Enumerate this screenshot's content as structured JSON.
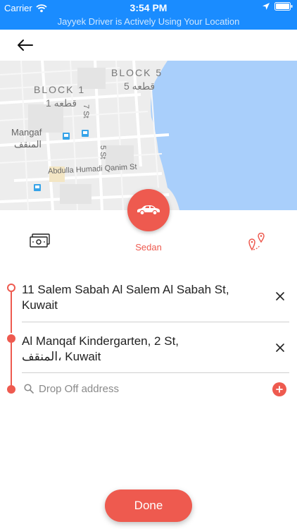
{
  "status_bar": {
    "carrier": "Carrier",
    "time": "3:54 PM",
    "icons": [
      "wifi-icon",
      "location-arrow-icon",
      "battery-icon"
    ]
  },
  "location_banner": "Jayyek Driver is Actively Using Your Location",
  "nav": {
    "back_icon": "arrow-left-icon"
  },
  "map": {
    "labels": {
      "block1_en": "BLOCK 1",
      "block1_ar": "قطعه 1",
      "block5_en": "BLOCK 5",
      "block5_ar": "قطعه 5",
      "area_en": "Mangaf",
      "area_ar": "المنقف",
      "street_7": "7 St",
      "street_5": "5 St",
      "street_main": "Abdulla Humadi Qanim St"
    }
  },
  "vehicle": {
    "label": "Sedan",
    "icon": "car-icon"
  },
  "payment_icon": "cash-icon",
  "route_icon": "route-pins-icon",
  "route": {
    "pickup": {
      "address": "11 Salem Sabah Al Salem Al Sabah St, Kuwait"
    },
    "stop": {
      "address_line1": "Al Manqaf Kindergarten, 2 St,",
      "address_line2": "المنقف، Kuwait"
    },
    "dropoff": {
      "placeholder": "Drop Off address",
      "value": ""
    }
  },
  "done_label": "Done",
  "colors": {
    "accent": "#ee5a4f",
    "status_bar": "#1a8cff",
    "water": "#a9cffb",
    "map_land": "#eeeeee"
  }
}
